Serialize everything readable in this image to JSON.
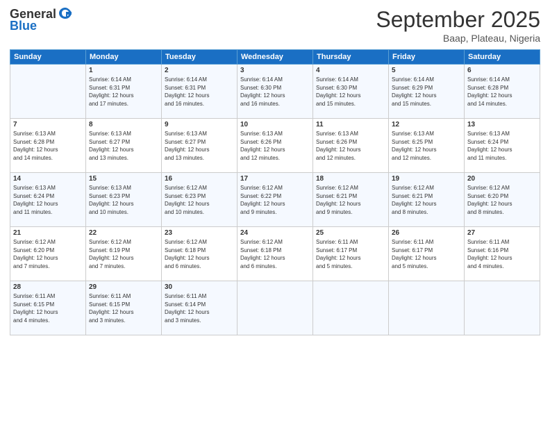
{
  "logo": {
    "line1": "General",
    "line2": "Blue"
  },
  "title": "September 2025",
  "subtitle": "Baap, Plateau, Nigeria",
  "columns": [
    "Sunday",
    "Monday",
    "Tuesday",
    "Wednesday",
    "Thursday",
    "Friday",
    "Saturday"
  ],
  "weeks": [
    [
      {
        "day": "",
        "info": ""
      },
      {
        "day": "1",
        "info": "Sunrise: 6:14 AM\nSunset: 6:31 PM\nDaylight: 12 hours\nand 17 minutes."
      },
      {
        "day": "2",
        "info": "Sunrise: 6:14 AM\nSunset: 6:31 PM\nDaylight: 12 hours\nand 16 minutes."
      },
      {
        "day": "3",
        "info": "Sunrise: 6:14 AM\nSunset: 6:30 PM\nDaylight: 12 hours\nand 16 minutes."
      },
      {
        "day": "4",
        "info": "Sunrise: 6:14 AM\nSunset: 6:30 PM\nDaylight: 12 hours\nand 15 minutes."
      },
      {
        "day": "5",
        "info": "Sunrise: 6:14 AM\nSunset: 6:29 PM\nDaylight: 12 hours\nand 15 minutes."
      },
      {
        "day": "6",
        "info": "Sunrise: 6:14 AM\nSunset: 6:28 PM\nDaylight: 12 hours\nand 14 minutes."
      }
    ],
    [
      {
        "day": "7",
        "info": "Sunrise: 6:13 AM\nSunset: 6:28 PM\nDaylight: 12 hours\nand 14 minutes."
      },
      {
        "day": "8",
        "info": "Sunrise: 6:13 AM\nSunset: 6:27 PM\nDaylight: 12 hours\nand 13 minutes."
      },
      {
        "day": "9",
        "info": "Sunrise: 6:13 AM\nSunset: 6:27 PM\nDaylight: 12 hours\nand 13 minutes."
      },
      {
        "day": "10",
        "info": "Sunrise: 6:13 AM\nSunset: 6:26 PM\nDaylight: 12 hours\nand 12 minutes."
      },
      {
        "day": "11",
        "info": "Sunrise: 6:13 AM\nSunset: 6:26 PM\nDaylight: 12 hours\nand 12 minutes."
      },
      {
        "day": "12",
        "info": "Sunrise: 6:13 AM\nSunset: 6:25 PM\nDaylight: 12 hours\nand 12 minutes."
      },
      {
        "day": "13",
        "info": "Sunrise: 6:13 AM\nSunset: 6:24 PM\nDaylight: 12 hours\nand 11 minutes."
      }
    ],
    [
      {
        "day": "14",
        "info": "Sunrise: 6:13 AM\nSunset: 6:24 PM\nDaylight: 12 hours\nand 11 minutes."
      },
      {
        "day": "15",
        "info": "Sunrise: 6:13 AM\nSunset: 6:23 PM\nDaylight: 12 hours\nand 10 minutes."
      },
      {
        "day": "16",
        "info": "Sunrise: 6:12 AM\nSunset: 6:23 PM\nDaylight: 12 hours\nand 10 minutes."
      },
      {
        "day": "17",
        "info": "Sunrise: 6:12 AM\nSunset: 6:22 PM\nDaylight: 12 hours\nand 9 minutes."
      },
      {
        "day": "18",
        "info": "Sunrise: 6:12 AM\nSunset: 6:21 PM\nDaylight: 12 hours\nand 9 minutes."
      },
      {
        "day": "19",
        "info": "Sunrise: 6:12 AM\nSunset: 6:21 PM\nDaylight: 12 hours\nand 8 minutes."
      },
      {
        "day": "20",
        "info": "Sunrise: 6:12 AM\nSunset: 6:20 PM\nDaylight: 12 hours\nand 8 minutes."
      }
    ],
    [
      {
        "day": "21",
        "info": "Sunrise: 6:12 AM\nSunset: 6:20 PM\nDaylight: 12 hours\nand 7 minutes."
      },
      {
        "day": "22",
        "info": "Sunrise: 6:12 AM\nSunset: 6:19 PM\nDaylight: 12 hours\nand 7 minutes."
      },
      {
        "day": "23",
        "info": "Sunrise: 6:12 AM\nSunset: 6:18 PM\nDaylight: 12 hours\nand 6 minutes."
      },
      {
        "day": "24",
        "info": "Sunrise: 6:12 AM\nSunset: 6:18 PM\nDaylight: 12 hours\nand 6 minutes."
      },
      {
        "day": "25",
        "info": "Sunrise: 6:11 AM\nSunset: 6:17 PM\nDaylight: 12 hours\nand 5 minutes."
      },
      {
        "day": "26",
        "info": "Sunrise: 6:11 AM\nSunset: 6:17 PM\nDaylight: 12 hours\nand 5 minutes."
      },
      {
        "day": "27",
        "info": "Sunrise: 6:11 AM\nSunset: 6:16 PM\nDaylight: 12 hours\nand 4 minutes."
      }
    ],
    [
      {
        "day": "28",
        "info": "Sunrise: 6:11 AM\nSunset: 6:15 PM\nDaylight: 12 hours\nand 4 minutes."
      },
      {
        "day": "29",
        "info": "Sunrise: 6:11 AM\nSunset: 6:15 PM\nDaylight: 12 hours\nand 3 minutes."
      },
      {
        "day": "30",
        "info": "Sunrise: 6:11 AM\nSunset: 6:14 PM\nDaylight: 12 hours\nand 3 minutes."
      },
      {
        "day": "",
        "info": ""
      },
      {
        "day": "",
        "info": ""
      },
      {
        "day": "",
        "info": ""
      },
      {
        "day": "",
        "info": ""
      }
    ]
  ]
}
